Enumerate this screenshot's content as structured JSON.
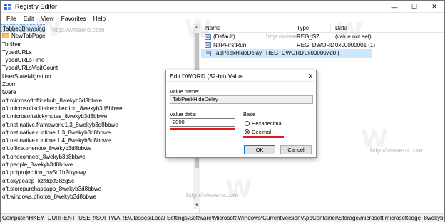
{
  "window": {
    "title": "Registry Editor",
    "controls": {
      "minimize": "—",
      "maximize": "☐",
      "close": "✕"
    }
  },
  "menu": [
    "File",
    "Edit",
    "View",
    "Favorites",
    "Help"
  ],
  "tree": [
    {
      "label": "TabbedBrowsing",
      "selected": true
    },
    {
      "label": "NewTabPage",
      "folder": true
    },
    {
      "label": "Toolbar"
    },
    {
      "label": "TypedURLs"
    },
    {
      "label": "TypedURLsTime"
    },
    {
      "label": "TypedURLsVisitCount"
    },
    {
      "label": "UserStateMigration"
    },
    {
      "label": "Zoom"
    },
    {
      "label": "tware"
    },
    {
      "label": "oft.microsoftofficehub_8wekyb3d8bbwe"
    },
    {
      "label": "oft.microsoftsolitairecollection_8wekyb3d8bbwe"
    },
    {
      "label": "oft.microsoftstickynotes_8wekyb3d8bbwe"
    },
    {
      "label": "oft.net.native.framework.1.3_8wekyb3d8bbwe"
    },
    {
      "label": "oft.net.native.runtime.1.3_8wekyb3d8bbwe"
    },
    {
      "label": "oft.net.native.runtime.1.4_8wekyb3d8bbwe"
    },
    {
      "label": "oft.office.onenote_8wekyb3d8bbwe"
    },
    {
      "label": "oft.oneconnect_8wekyb3d8bbwe"
    },
    {
      "label": "oft.people_8wekyb3d8bbwe"
    },
    {
      "label": "oft.ppiprojection_cw5n1h2txyewy"
    },
    {
      "label": "oft.skypeapp_kzf8qxf38zg5c"
    },
    {
      "label": "oft.storepurchaseapp_8wekyb3d8bbwe"
    },
    {
      "label": "oft.windows.photos_8wekyb3d8bbwe"
    }
  ],
  "columns": {
    "name": "Name",
    "type": "Type",
    "data": "Data"
  },
  "values": [
    {
      "name": "(Default)",
      "type": "REG_SZ",
      "data": "(value not set)",
      "icon": "ab"
    },
    {
      "name": "NTPFirstRun",
      "type": "REG_DWORD",
      "data": "0x00000001 (1)",
      "icon": "bin"
    },
    {
      "name": "TabPeekHideDelay",
      "type": "REG_DWORD",
      "data": "0x000007d0 (",
      "icon": "bin",
      "selected": true
    }
  ],
  "status": "Computer\\HKEY_CURRENT_USER\\SOFTWARE\\Classes\\Local Settings\\Software\\Microsoft\\Windows\\CurrentVersion\\AppContainer\\Storage\\microsoft.microsoftedge_8wekyb3d8bbt",
  "dialog": {
    "title": "Edit DWORD (32-bit) Value",
    "close": "✕",
    "value_name_label": "Value name:",
    "value_name": "TabPeekHideDelay",
    "value_data_label": "Value data:",
    "value_data": "2000",
    "base_label": "Base",
    "hex_label": "Hexadecimal",
    "dec_label": "Decimal",
    "base_selected": "Decimal",
    "ok": "OK",
    "cancel": "Cancel"
  },
  "watermark": "http://winaero.com",
  "colors": {
    "highlight": "#e01b1b",
    "selection": "#cce8ff",
    "accent": "#0078d7"
  }
}
